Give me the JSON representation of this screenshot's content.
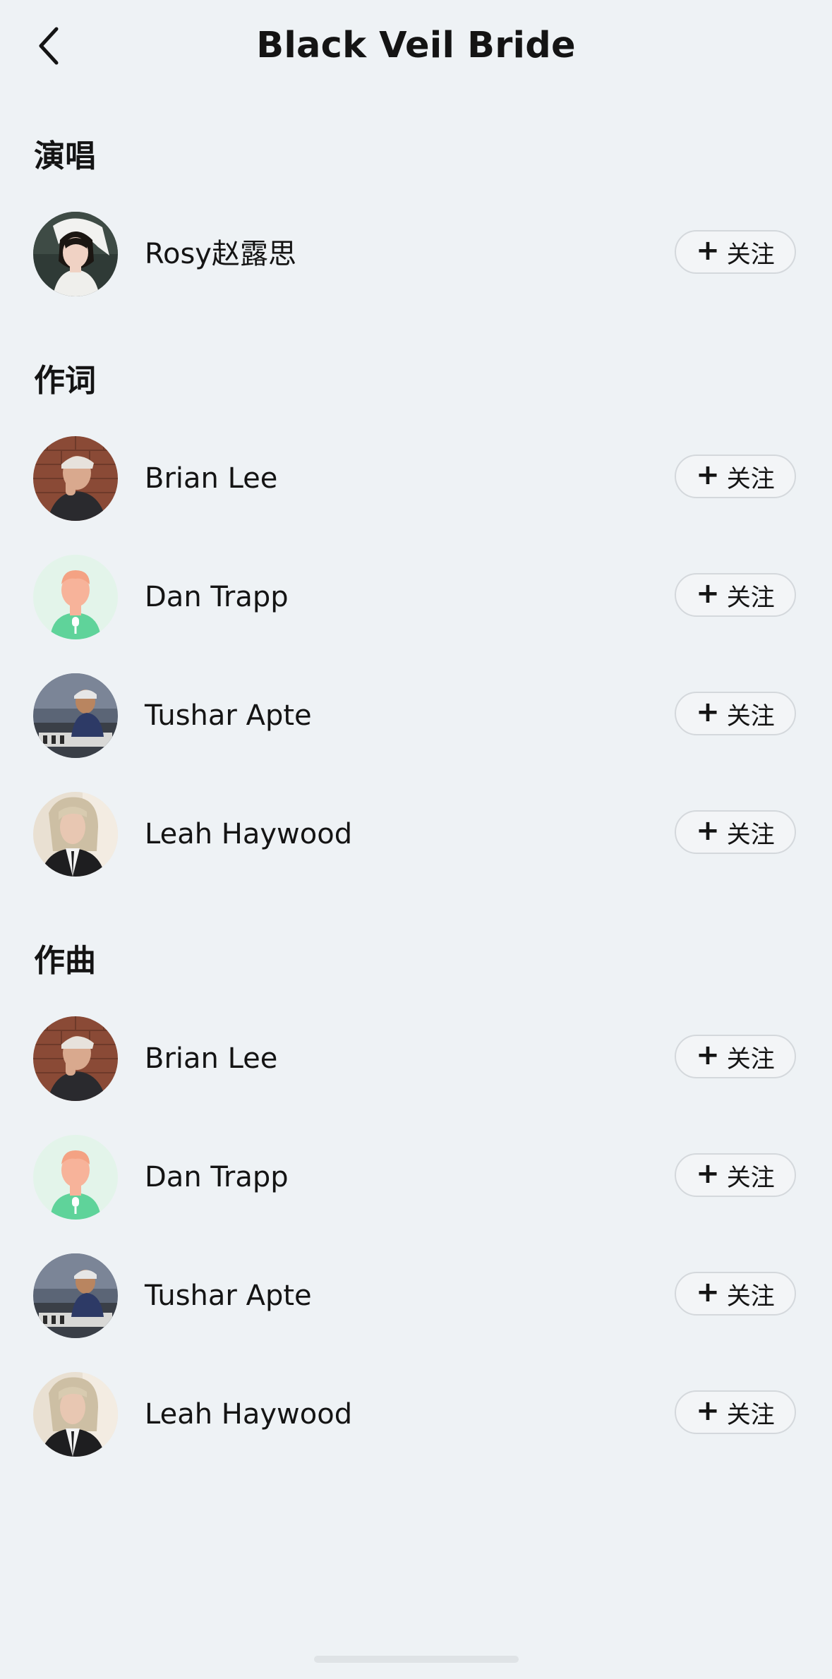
{
  "header": {
    "title": "Black Veil Bride",
    "back_icon": "chevron-left-icon"
  },
  "sections": [
    {
      "title": "演唱",
      "artists": [
        {
          "name": "Rosy赵露思",
          "avatar": "photo-woman-veil",
          "follow_label": "关注"
        }
      ]
    },
    {
      "title": "作词",
      "artists": [
        {
          "name": "Brian Lee",
          "avatar": "photo-man-cap-brick",
          "follow_label": "关注"
        },
        {
          "name": "Dan Trapp",
          "avatar": "default-mic-avatar",
          "follow_label": "关注"
        },
        {
          "name": "Tushar Apte",
          "avatar": "photo-man-studio",
          "follow_label": "关注"
        },
        {
          "name": "Leah Haywood",
          "avatar": "photo-woman-suit",
          "follow_label": "关注"
        }
      ]
    },
    {
      "title": "作曲",
      "artists": [
        {
          "name": "Brian Lee",
          "avatar": "photo-man-cap-brick",
          "follow_label": "关注"
        },
        {
          "name": "Dan Trapp",
          "avatar": "default-mic-avatar",
          "follow_label": "关注"
        },
        {
          "name": "Tushar Apte",
          "avatar": "photo-man-studio",
          "follow_label": "关注"
        },
        {
          "name": "Leah Haywood",
          "avatar": "photo-woman-suit",
          "follow_label": "关注"
        }
      ]
    }
  ],
  "follow_plus": "+",
  "colors": {
    "background": "#eef2f5",
    "text": "#141414",
    "button_border": "#d4d8dc",
    "default_avatar_green": "#5fd39a",
    "default_avatar_skin": "#f7b39a"
  }
}
